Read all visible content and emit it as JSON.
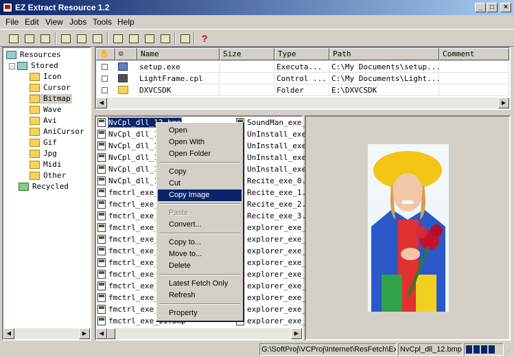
{
  "window": {
    "title": "EZ Extract Resource 1.2",
    "controls": [
      "_",
      "□",
      "×"
    ]
  },
  "menu": [
    "File",
    "Edit",
    "View",
    "Jobs",
    "Tools",
    "Help"
  ],
  "toolbar_icons": [
    "open-icon",
    "save-icon",
    "find-icon",
    "copy-icon",
    "cut-icon",
    "paste-icon",
    "extract-icon",
    "folder-up-icon",
    "export-icon",
    "delete-icon",
    "options-icon",
    "help-icon"
  ],
  "tree": {
    "root": "Resources",
    "stored": "Stored",
    "children": [
      "Icon",
      "Cursor",
      "Bitmap",
      "Wave",
      "Avi",
      "AniCursor",
      "Gif",
      "Jpg",
      "Midi",
      "Other"
    ],
    "recycled": "Recycled",
    "selected": "Bitmap"
  },
  "grid": {
    "columns": [
      "Name",
      "Size",
      "Type",
      "Path",
      "Comment"
    ],
    "rows": [
      {
        "name": "setup.exe",
        "size": "",
        "type": "Executa...",
        "path": "C:\\My Documents\\setup...",
        "comment": ""
      },
      {
        "name": "LightFrame.cpl",
        "size": "",
        "type": "Control ...",
        "path": "C:\\My Documents\\Light...",
        "comment": ""
      },
      {
        "name": "DXVCSDK",
        "size": "",
        "type": "Folder",
        "path": "E:\\DXVCSDK",
        "comment": ""
      }
    ]
  },
  "files": {
    "col1": [
      "NvCpl_dll_12.bmp",
      "NvCpl_dll_13",
      "NvCpl_dll_14",
      "NvCpl_dll_15",
      "NvCpl_dll_16",
      "NvCpl_dll_17",
      "fmctrl_exe_0",
      "fmctrl_exe_1",
      "fmctrl_exe_2",
      "fmctrl_exe_3",
      "fmctrl_exe_4",
      "fmctrl_exe_5",
      "fmctrl_exe_6",
      "fmctrl_exe_7",
      "fmctrl_exe_8",
      "fmctrl_exe_9",
      "fmctrl_exe_10",
      "fmctrl_exe_11.bmp"
    ],
    "col2": [
      "SoundMan_exe_",
      "UnInstall_exe",
      "UnInstall_exe",
      "UnInstall_exe",
      "UnInstall_exe",
      "Recite_exe_0.",
      "Recite_exe_1.",
      "Recite_exe_2.",
      "Recite_exe_3.",
      "explorer_exe_",
      "explorer_exe_",
      "explorer_exe_",
      "explorer_exe_",
      "explorer_exe_",
      "explorer_exe_",
      "explorer_exe_",
      "explorer_exe_",
      "explorer_exe_"
    ]
  },
  "context_menu": [
    {
      "label": "Open",
      "state": "normal"
    },
    {
      "label": "Open With",
      "state": "normal"
    },
    {
      "label": "Open Folder",
      "state": "normal"
    },
    {
      "sep": true
    },
    {
      "label": "Copy",
      "state": "normal"
    },
    {
      "label": "Cut",
      "state": "normal"
    },
    {
      "label": "Copy Image",
      "state": "highlighted"
    },
    {
      "sep": true
    },
    {
      "label": "Paste",
      "state": "disabled"
    },
    {
      "label": "Convert...",
      "state": "normal"
    },
    {
      "sep": true
    },
    {
      "label": "Copy to...",
      "state": "normal"
    },
    {
      "label": "Move to...",
      "state": "normal"
    },
    {
      "label": "Delete",
      "state": "normal"
    },
    {
      "sep": true
    },
    {
      "label": "Latest Fetch Only",
      "state": "normal"
    },
    {
      "label": "Refresh",
      "state": "normal"
    },
    {
      "sep": true
    },
    {
      "label": "Property",
      "state": "normal"
    }
  ],
  "status": {
    "path": "G:\\SoftProj\\VCProj\\Internet\\ResFetch\\Ex",
    "file": "NvCpl_dll_12.bmp",
    "progress_blocks": 4
  },
  "colors": {
    "title_start": "#0a246a",
    "title_end": "#a6caf0",
    "highlight": "#0a246a",
    "face": "#d4d0c8"
  }
}
